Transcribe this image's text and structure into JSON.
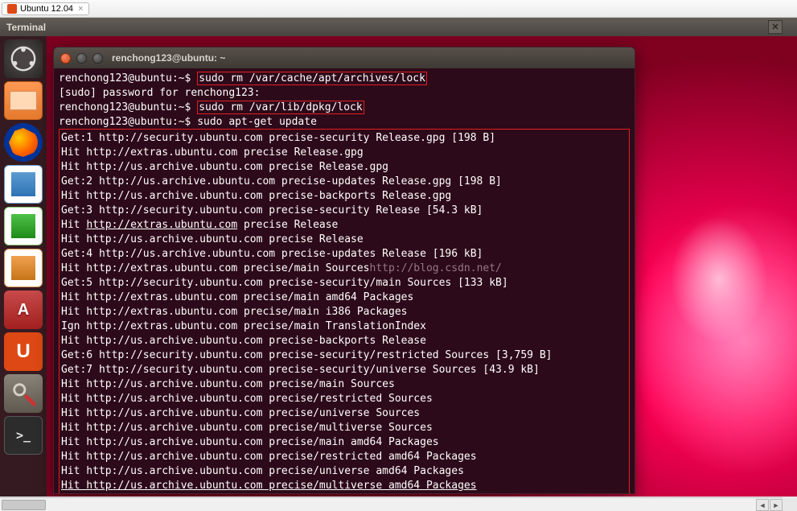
{
  "vm_tab_label": "Ubuntu 12.04",
  "unity_panel_title": "Terminal",
  "terminal_title": "renchong123@ubuntu: ~",
  "watermark": "http://blog.csdn.net/",
  "prompt_user": "renchong123@ubuntu",
  "prompt_path": "~",
  "lines": {
    "l1_cmd": "sudo rm /var/cache/apt/archives/lock",
    "l2": "[sudo] password for renchong123:",
    "l3_cmd": "sudo rm /var/lib/dpkg/lock",
    "l4_cmd": "sudo apt-get update",
    "o1": "Get:1 http://security.ubuntu.com precise-security Release.gpg [198 B]",
    "o2": "Hit http://extras.ubuntu.com precise Release.gpg",
    "o3": "Hit http://us.archive.ubuntu.com precise Release.gpg",
    "o4": "Get:2 http://us.archive.ubuntu.com precise-updates Release.gpg [198 B]",
    "o5": "Hit http://us.archive.ubuntu.com precise-backports Release.gpg",
    "o6": "Get:3 http://security.ubuntu.com precise-security Release [54.3 kB]",
    "o7a": "Hit ",
    "o7link": "http://extras.ubuntu.com",
    "o7b": " precise Release",
    "o8": "Hit http://us.archive.ubuntu.com precise Release",
    "o9": "Get:4 http://us.archive.ubuntu.com precise-updates Release [196 kB]",
    "o10": "Hit http://extras.ubuntu.com precise/main Sources",
    "o11": "Get:5 http://security.ubuntu.com precise-security/main Sources [133 kB]",
    "o12": "Hit http://extras.ubuntu.com precise/main amd64 Packages",
    "o13": "Hit http://extras.ubuntu.com precise/main i386 Packages",
    "o14": "Ign http://extras.ubuntu.com precise/main TranslationIndex",
    "o15": "Hit http://us.archive.ubuntu.com precise-backports Release",
    "o16": "Get:6 http://security.ubuntu.com precise-security/restricted Sources [3,759 B]",
    "o17": "Get:7 http://security.ubuntu.com precise-security/universe Sources [43.9 kB]",
    "o18": "Hit http://us.archive.ubuntu.com precise/main Sources",
    "o19": "Hit http://us.archive.ubuntu.com precise/restricted Sources",
    "o20": "Hit http://us.archive.ubuntu.com precise/universe Sources",
    "o21": "Hit http://us.archive.ubuntu.com precise/multiverse Sources",
    "o22": "Hit http://us.archive.ubuntu.com precise/main amd64 Packages",
    "o23": "Hit http://us.archive.ubuntu.com precise/restricted amd64 Packages",
    "o24": "Hit http://us.archive.ubuntu.com precise/universe amd64 Packages",
    "o25": "Hit http://us.archive.ubuntu.com precise/multiverse amd64 Packages"
  },
  "launcher": [
    "dash",
    "files",
    "firefox",
    "writer",
    "calc",
    "impress",
    "software",
    "ubuntu-one",
    "settings",
    "terminal"
  ]
}
